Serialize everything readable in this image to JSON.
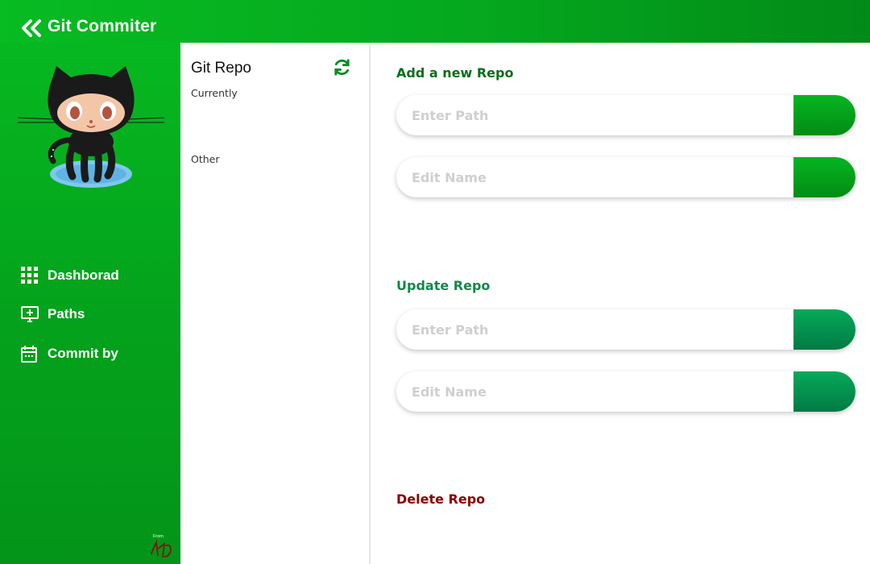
{
  "header": {
    "title": "Git Commiter",
    "back_icon": "double-chevron-left-icon"
  },
  "sidebar": {
    "mascot": "octocat-image",
    "items": [
      {
        "label": "Dashborad",
        "icon": "grid-icon"
      },
      {
        "label": "Paths",
        "icon": "monitor-plus-icon"
      },
      {
        "label": "Commit by",
        "icon": "calendar-icon"
      }
    ],
    "footer_label": "From"
  },
  "repo_panel": {
    "title": "Git Repo",
    "refresh_icon": "refresh-icon",
    "sections": [
      "Currently",
      "Other"
    ]
  },
  "main": {
    "add": {
      "heading": "Add a new Repo",
      "path_placeholder": "Enter Path",
      "name_placeholder": "Edit Name"
    },
    "update": {
      "heading": "Update Repo",
      "path_placeholder": "Enter Path",
      "name_placeholder": "Edit Name"
    },
    "delete": {
      "heading": "Delete Repo"
    }
  },
  "colors": {
    "brand_green": "#07bb22",
    "add_heading": "#0a6e1c",
    "update_heading": "#12894a",
    "delete_heading": "#8b0000"
  }
}
